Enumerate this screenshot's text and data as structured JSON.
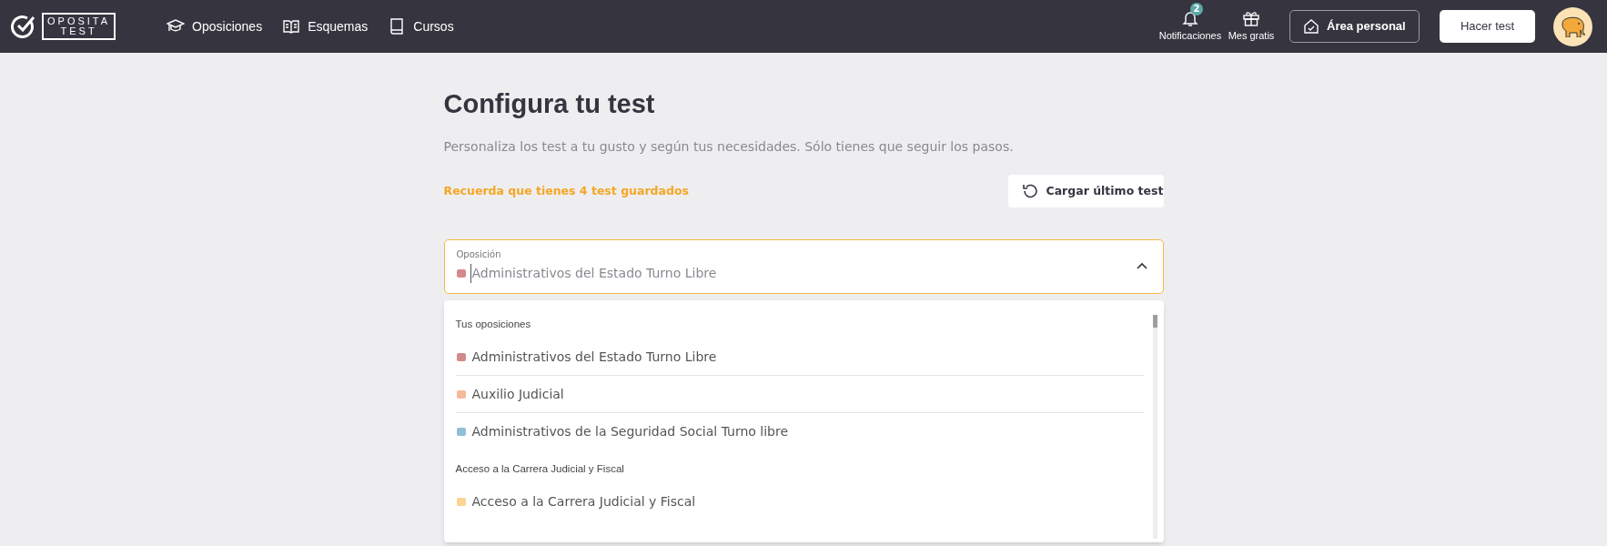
{
  "header": {
    "logo": {
      "top": "OPOSITA",
      "bottom": "TEST"
    },
    "nav": [
      {
        "label": "Oposiciones"
      },
      {
        "label": "Esquemas"
      },
      {
        "label": "Cursos"
      }
    ],
    "notifications": {
      "label": "Notificaciones",
      "badge": "2"
    },
    "gift": {
      "label": "Mes gratis"
    },
    "personal_button": "Área personal",
    "test_button": "Hacer test"
  },
  "main": {
    "title": "Configura tu test",
    "subtitle": "Personaliza los test a tu gusto y según tus necesidades. Sólo tienes que seguir los pasos.",
    "reminder": "Recuerda que tienes 4 test guardados",
    "load_button": "Cargar último test",
    "field": {
      "label": "Oposición",
      "value": "Administrativos del Estado Turno Libre",
      "color": "#d48a8a",
      "expanded": true
    },
    "dropdown": [
      {
        "label": "Tus oposiciones",
        "items": [
          {
            "name": "Administrativos del Estado Turno Libre",
            "color": "#d48a8a"
          },
          {
            "name": "Auxilio Judicial",
            "color": "#f7b99a"
          },
          {
            "name": "Administrativos de la Seguridad Social Turno libre",
            "color": "#8fc0d6"
          }
        ]
      },
      {
        "label": "Acceso a la Carrera Judicial y Fiscal",
        "items": [
          {
            "name": "Acceso a la Carrera Judicial y Fiscal",
            "color": "#fbd591"
          }
        ]
      }
    ]
  }
}
